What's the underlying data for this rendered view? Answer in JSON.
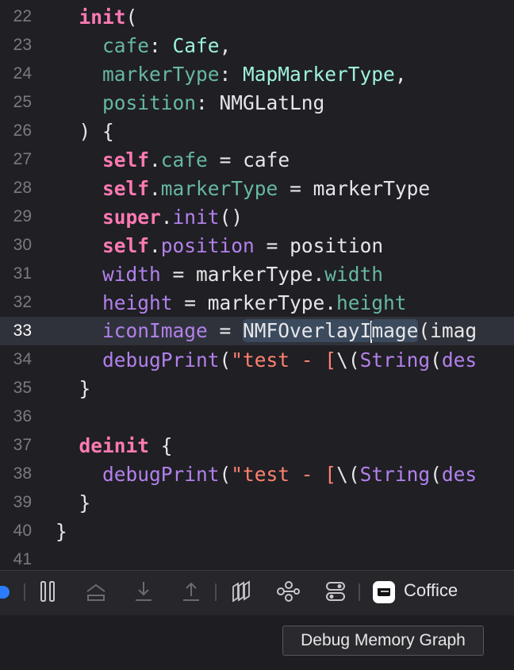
{
  "editor": {
    "lines": [
      {
        "num": "22",
        "tokens": [
          [
            "kw",
            "init"
          ],
          [
            "plain",
            "("
          ]
        ],
        "indent": "  "
      },
      {
        "num": "23",
        "tokens": [
          [
            "prop",
            "cafe"
          ],
          [
            "plain",
            ": "
          ],
          [
            "type",
            "Cafe"
          ],
          [
            "plain",
            ","
          ]
        ],
        "indent": "    "
      },
      {
        "num": "24",
        "tokens": [
          [
            "prop",
            "markerType"
          ],
          [
            "plain",
            ": "
          ],
          [
            "type",
            "MapMarkerType"
          ],
          [
            "plain",
            ","
          ]
        ],
        "indent": "    "
      },
      {
        "num": "25",
        "tokens": [
          [
            "prop",
            "position"
          ],
          [
            "plain",
            ": NMGLatLng"
          ]
        ],
        "indent": "    "
      },
      {
        "num": "26",
        "tokens": [
          [
            "plain",
            ") {"
          ]
        ],
        "indent": "  "
      },
      {
        "num": "27",
        "tokens": [
          [
            "kw",
            "self"
          ],
          [
            "plain",
            "."
          ],
          [
            "prop",
            "cafe"
          ],
          [
            "plain",
            " = cafe"
          ]
        ],
        "indent": "    "
      },
      {
        "num": "28",
        "tokens": [
          [
            "kw",
            "self"
          ],
          [
            "plain",
            "."
          ],
          [
            "prop",
            "markerType"
          ],
          [
            "plain",
            " = markerType"
          ]
        ],
        "indent": "    "
      },
      {
        "num": "29",
        "tokens": [
          [
            "kw",
            "super"
          ],
          [
            "plain",
            "."
          ],
          [
            "fn",
            "init"
          ],
          [
            "plain",
            "()"
          ]
        ],
        "indent": "    "
      },
      {
        "num": "30",
        "tokens": [
          [
            "kw",
            "self"
          ],
          [
            "plain",
            "."
          ],
          [
            "fn",
            "position"
          ],
          [
            "plain",
            " = position"
          ]
        ],
        "indent": "    "
      },
      {
        "num": "31",
        "tokens": [
          [
            "fn",
            "width"
          ],
          [
            "plain",
            " = markerType."
          ],
          [
            "prop",
            "width"
          ]
        ],
        "indent": "    "
      },
      {
        "num": "32",
        "tokens": [
          [
            "fn",
            "height"
          ],
          [
            "plain",
            " = markerType."
          ],
          [
            "prop",
            "height"
          ]
        ],
        "indent": "    "
      },
      {
        "num": "33",
        "tokens": [
          [
            "fn",
            "iconImage"
          ],
          [
            "plain",
            " = "
          ],
          [
            "hl",
            "NMFOverlayI"
          ],
          [
            "caret",
            ""
          ],
          [
            "hl",
            "mage"
          ],
          [
            "plain",
            "(imag"
          ]
        ],
        "indent": "    ",
        "current": true
      },
      {
        "num": "34",
        "tokens": [
          [
            "fn",
            "debugPrint"
          ],
          [
            "plain",
            "("
          ],
          [
            "str",
            "\"test - ["
          ],
          [
            "plain",
            "\\("
          ],
          [
            "fn",
            "String"
          ],
          [
            "plain",
            "("
          ],
          [
            "fn",
            "des"
          ]
        ],
        "indent": "    "
      },
      {
        "num": "35",
        "tokens": [
          [
            "plain",
            "}"
          ]
        ],
        "indent": "  "
      },
      {
        "num": "36",
        "tokens": [],
        "indent": ""
      },
      {
        "num": "37",
        "tokens": [
          [
            "kw",
            "deinit"
          ],
          [
            "plain",
            " {"
          ]
        ],
        "indent": "  "
      },
      {
        "num": "38",
        "tokens": [
          [
            "fn",
            "debugPrint"
          ],
          [
            "plain",
            "("
          ],
          [
            "str",
            "\"test - ["
          ],
          [
            "plain",
            "\\("
          ],
          [
            "fn",
            "String"
          ],
          [
            "plain",
            "("
          ],
          [
            "fn",
            "des"
          ]
        ],
        "indent": "    "
      },
      {
        "num": "39",
        "tokens": [
          [
            "plain",
            "}"
          ]
        ],
        "indent": "  "
      },
      {
        "num": "40",
        "tokens": [
          [
            "plain",
            "}"
          ]
        ],
        "indent": ""
      },
      {
        "num": "41",
        "tokens": [],
        "indent": ""
      }
    ]
  },
  "debugbar": {
    "app_label": "Coffice",
    "buttons": [
      "pause-icon",
      "step-over-icon",
      "step-into-icon",
      "step-out-icon",
      "debug-view-hierarchy-icon",
      "debug-memory-graph-icon",
      "environment-overrides-icon"
    ]
  },
  "tooltip": {
    "text": "Debug Memory Graph"
  },
  "colors": {
    "background": "#1f1f24",
    "keyword": "#ff7ab2",
    "property": "#67b7a4",
    "type": "#9ef1dd",
    "function": "#b281eb",
    "string": "#ff8170"
  }
}
